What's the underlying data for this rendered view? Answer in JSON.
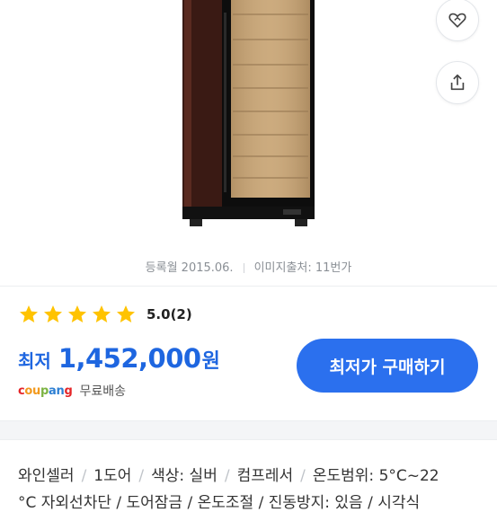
{
  "product": {
    "registered": "등록월 2015.06.",
    "image_source": "이미지출처: 11번가"
  },
  "rating": {
    "stars": 5,
    "score": "5.0",
    "count": "(2)"
  },
  "price": {
    "label": "최저",
    "amount": "1,452,000",
    "unit": "원"
  },
  "buy_button": "최저가 구매하기",
  "shipping": {
    "seller": "coupang",
    "text": "무료배송"
  },
  "specs": [
    "와인셀러",
    "1도어",
    "색상: 실버",
    "컴프레서",
    "온도범위: 5°C~22"
  ],
  "specs_cut": "°C  자외선차단  /  도어잠금  /  온도조절  /  진동방지: 있음  /  시각식",
  "colors": {
    "accent": "#2b70ee",
    "star": "#ffc300",
    "coupang_c": "#e52528",
    "coupang_o": "#f29a1f",
    "coupang_u": "#7cb342",
    "coupang_p": "#2d7fd3"
  },
  "icons": [
    "heart-icon",
    "share-icon",
    "star-icon"
  ]
}
